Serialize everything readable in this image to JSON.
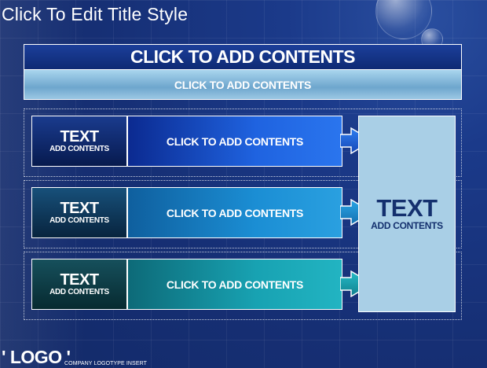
{
  "slide": {
    "title": "Click To Edit Title Style",
    "header": {
      "main": "CLICK TO ADD CONTENTS",
      "sub": "CLICK TO ADD CONTENTS"
    },
    "rows": [
      {
        "label_big": "TEXT",
        "label_small": "ADD CONTENTS",
        "body": "CLICK TO ADD CONTENTS"
      },
      {
        "label_big": "TEXT",
        "label_small": "ADD CONTENTS",
        "body": "CLICK TO ADD CONTENTS"
      },
      {
        "label_big": "TEXT",
        "label_small": "ADD CONTENTS",
        "body": "CLICK TO ADD CONTENTS"
      }
    ],
    "side_panel": {
      "big": "TEXT",
      "small": "ADD CONTENTS"
    },
    "footer": {
      "logo": "' LOGO '",
      "tagline": "COMPANY LOGOTYPE INSERT"
    }
  },
  "colors": {
    "background": "#162f74",
    "panel": "#a9cfe6",
    "row1_label": "#0c2060",
    "row1_body": "#1d5fd6",
    "row2_label": "#0c3a5a",
    "row2_body": "#1c8bd0",
    "row3_label": "#0c3a44",
    "row3_body": "#1aa3b0"
  }
}
